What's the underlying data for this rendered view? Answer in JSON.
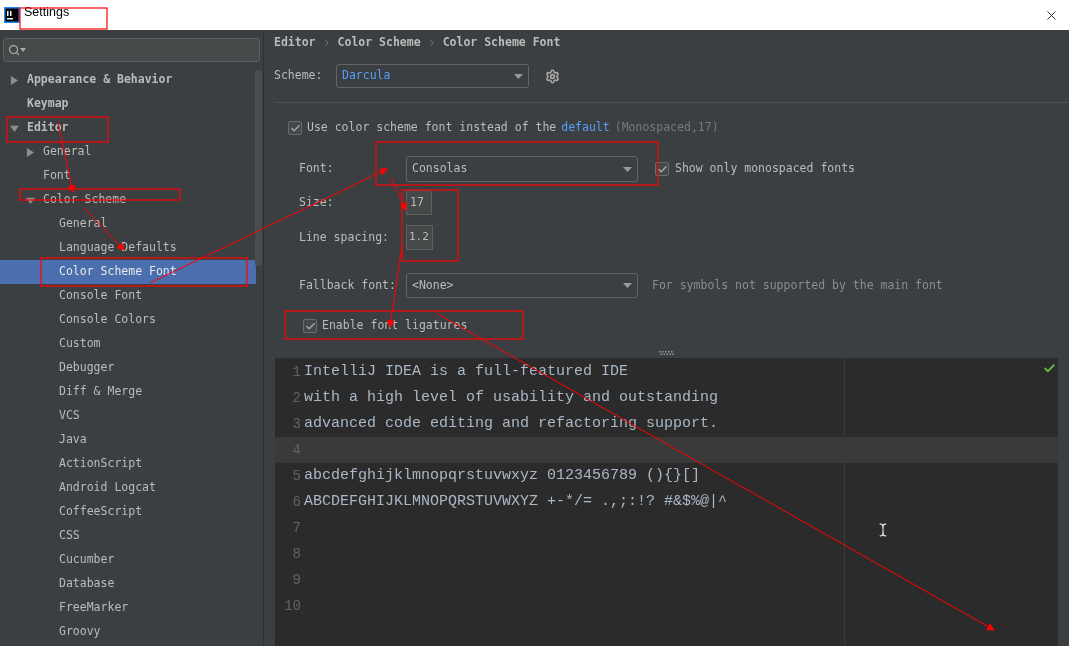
{
  "window": {
    "title": "Settings"
  },
  "sidebar": {
    "tree": [
      {
        "label": "Appearance & Behavior",
        "expanded": false,
        "selected": false
      },
      {
        "label": "Keymap",
        "selected": false
      },
      {
        "label": "Editor",
        "expanded": true,
        "selected": false,
        "children": [
          {
            "label": "General",
            "expanded": false,
            "selected": false
          },
          {
            "label": "Font",
            "selected": false
          },
          {
            "label": "Color Scheme",
            "expanded": true,
            "selected": false,
            "children": [
              {
                "label": "General",
                "selected": false
              },
              {
                "label": "Language Defaults",
                "selected": false
              },
              {
                "label": "Color Scheme Font",
                "selected": true
              },
              {
                "label": "Console Font",
                "selected": false
              },
              {
                "label": "Console Colors",
                "selected": false
              },
              {
                "label": "Custom",
                "selected": false
              },
              {
                "label": "Debugger",
                "selected": false
              },
              {
                "label": "Diff & Merge",
                "selected": false
              },
              {
                "label": "VCS",
                "selected": false
              },
              {
                "label": "Java",
                "selected": false
              },
              {
                "label": "ActionScript",
                "selected": false
              },
              {
                "label": "Android Logcat",
                "selected": false
              },
              {
                "label": "CoffeeScript",
                "selected": false
              },
              {
                "label": "CSS",
                "selected": false
              },
              {
                "label": "Cucumber",
                "selected": false
              },
              {
                "label": "Database",
                "selected": false
              },
              {
                "label": "FreeMarker",
                "selected": false
              },
              {
                "label": "Groovy",
                "selected": false
              }
            ]
          }
        ]
      }
    ]
  },
  "breadcrumb": [
    "Editor",
    "Color Scheme",
    "Color Scheme Font"
  ],
  "scheme": {
    "label": "Scheme:",
    "value": "Darcula"
  },
  "use_scheme_font": {
    "checked": true,
    "text": "Use color scheme font instead of the",
    "link": "default",
    "note": "(Monospaced,17)"
  },
  "font": {
    "label": "Font:",
    "value": "Consolas"
  },
  "monospaced_only": {
    "checked": true,
    "label": "Show only monospaced fonts"
  },
  "size": {
    "label": "Size:",
    "value": "17"
  },
  "line_spacing": {
    "label": "Line spacing:",
    "value": "1.2"
  },
  "fallback": {
    "label": "Fallback font:",
    "value": "<None>",
    "hint": "For symbols not supported by the main font"
  },
  "ligatures": {
    "checked": true,
    "label": "Enable font ligatures"
  },
  "preview": {
    "lines": [
      {
        "number": "1",
        "text": "IntelliJ IDEA is a full-featured IDE",
        "current": false
      },
      {
        "number": "2",
        "text": "with a high level of usability and outstanding",
        "current": false
      },
      {
        "number": "3",
        "text": "advanced code editing and refactoring support.",
        "current": false
      },
      {
        "number": "4",
        "current": true
      },
      {
        "number": "5",
        "text": "abcdefghijklmnopqrstuvwxyz 0123456789 (){}[]",
        "current": false
      },
      {
        "number": "6",
        "text": "ABCDEFGHIJKLMNOPQRSTUVWXYZ +-*/= .,;:!? #&$%@|^",
        "current": false
      },
      {
        "number": "7",
        "current": false
      },
      {
        "number": "8",
        "current": false
      },
      {
        "number": "9",
        "current": false
      },
      {
        "number": "10",
        "current": false
      }
    ]
  }
}
